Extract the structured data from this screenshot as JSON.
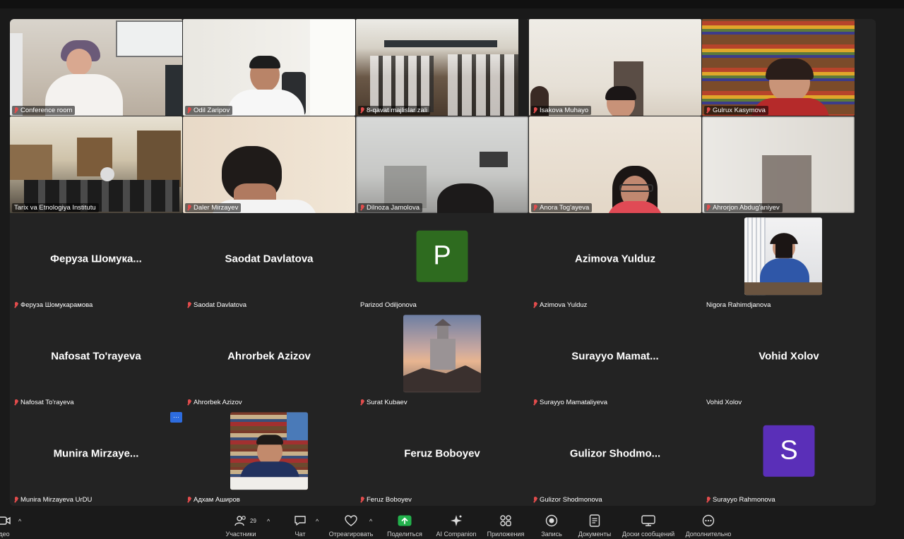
{
  "video_tiles": [
    {
      "name": "Conference room"
    },
    {
      "name": "Odil Zaripov"
    },
    {
      "name": "8-qavat majlislar zali"
    },
    {
      "name": "Isakova Muhayo"
    },
    {
      "name": "Gulrux Kasymova"
    },
    {
      "name": "Tarix va Etnologiya Institutu"
    },
    {
      "name": "Daler Mirzayev"
    },
    {
      "name": "Dilnoza Jamolova"
    },
    {
      "name": "Anora Tog'ayeva"
    },
    {
      "name": "Ahrorjon Abdug'aniyev"
    }
  ],
  "participant_tiles": [
    {
      "display": "Феруза  Шомука...",
      "name": "Феруза Шомукарамова",
      "muted": true
    },
    {
      "display": "Saodat Davlatova",
      "name": "Saodat Davlatova",
      "muted": true
    },
    {
      "letter": "P",
      "letter_color": "#2e6b1f",
      "name": "Parizod Odiljonova",
      "muted": false
    },
    {
      "display": "Azimova Yulduz",
      "name": "Azimova Yulduz",
      "muted": true
    },
    {
      "photo": "woman-office",
      "name": "Nigora Rahimdjanova",
      "muted": false
    },
    {
      "display": "Nafosat To'rayeva",
      "name": "Nafosat To'rayeva",
      "muted": true
    },
    {
      "display": "Ahrorbek Azizov",
      "name": "Ahrorbek Azizov",
      "muted": true
    },
    {
      "photo": "castle",
      "name": "Surat Kubaev",
      "muted": true
    },
    {
      "display": "Surayyo  Mamat...",
      "name": "Surayyo Mamataliyeva",
      "muted": true
    },
    {
      "display": "Vohid Xolov",
      "name": "Vohid Xolov",
      "muted": false
    },
    {
      "display": "Munira  Mirzaye...",
      "name": "Munira Mirzayeva UrDU",
      "muted": true
    },
    {
      "photo": "man-books",
      "name": "Адхам Аширов",
      "muted": true
    },
    {
      "display": "Feruz Boboyev",
      "name": "Feruz Boboyev",
      "muted": true
    },
    {
      "display": "Gulizor  Shodmo...",
      "name": "Gulizor Shodmonova",
      "muted": true
    },
    {
      "letter": "S",
      "letter_color": "#5a2fb8",
      "name": "Surayyo Rahmonova",
      "muted": true
    }
  ],
  "more_button": "···",
  "toolbar": {
    "video": "део",
    "participants": "Участники",
    "participants_count": "29",
    "chat": "Чат",
    "react": "Отреагировать",
    "share": "Поделиться",
    "ai": "AI Companion",
    "apps": "Приложения",
    "record": "Запись",
    "docs": "Документы",
    "boards": "Доски сообщений",
    "more": "Дополнительно"
  },
  "colors": {
    "active_speaker": "#3fd36b",
    "muted_icon": "#e24c4c",
    "share_green": "#22b14c",
    "more_button": "#2d6cdf"
  }
}
